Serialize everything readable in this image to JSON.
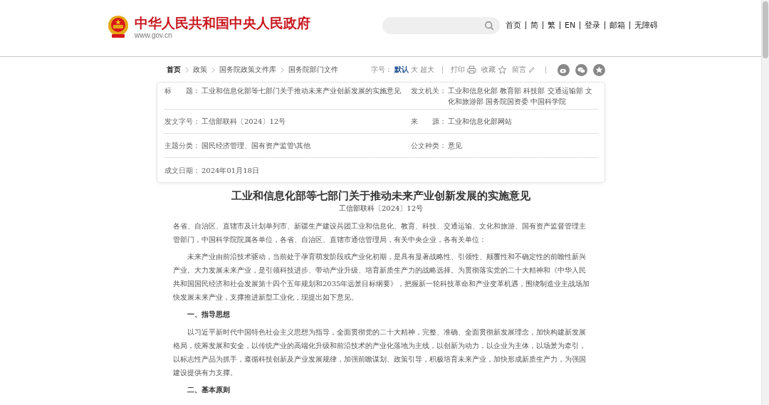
{
  "header": {
    "site_title": "中华人民共和国中央人民政府",
    "site_url": "www.gov.cn",
    "nav": [
      "首页",
      "简",
      "繁",
      "EN",
      "登录",
      "邮箱",
      "无障碍"
    ]
  },
  "breadcrumb": [
    "首页",
    "政策",
    "国务院政策文件库",
    "国务院部门文件"
  ],
  "toolbar": {
    "font_size_label": "字号：",
    "font_sizes": [
      {
        "label": "默认",
        "selected": true
      },
      {
        "label": "大",
        "selected": false
      },
      {
        "label": "超大",
        "selected": false
      }
    ],
    "print": "打印",
    "favorite": "收藏",
    "comment": "留言"
  },
  "info": [
    {
      "label": "标　　题：",
      "value": "工业和信息化部等七部门关于推动未来产业创新发展的实施意见"
    },
    {
      "label": "发文机关：",
      "value": "工业和信息化部  教育部  科技部  交通运输部  文化和旅游部  国务院国资委  中国科学院"
    },
    {
      "label": "发文字号：",
      "value": "工信部联科〔2024〕12号"
    },
    {
      "label": "来　　源：",
      "value": "工业和信息化部网站"
    },
    {
      "label": "主题分类：",
      "value": "国民经济管理、国有资产监管\\其他"
    },
    {
      "label": "公文种类：",
      "value": "意见"
    },
    {
      "label": "成文日期：",
      "value": "2024年01月18日"
    }
  ],
  "article": {
    "title": "工业和信息化部等七部门关于推动未来产业创新发展的实施意见",
    "doc_number": "工信部联科〔2024〕12号",
    "blocks": [
      {
        "kind": "salutation",
        "text": "各省、自治区、直辖市及计划单列市、新疆生产建设兵团工业和信息化、教育、科技、交通运输、文化和旅游、国有资产监督管理主管部门，中国科学院院属各单位，各省、自治区、直辖市通信管理局，有关中央企业，各有关单位："
      },
      {
        "kind": "paragraph",
        "text": "未来产业由前沿技术驱动，当前处于孕育萌发阶段或产业化初期，是具有显著战略性、引领性、颠覆性和不确定性的前瞻性新兴产业。大力发展未来产业，是引领科技进步、带动产业升级、培育新质生产力的战略选择。为贯彻落实党的二十大精神和《中华人民共和国国民经济和社会发展第十四个五年规划和2035年远景目标纲要》，把握新一轮科技革命和产业变革机遇，围绕制造业主战场加快发展未来产业，支撑推进新型工业化，现提出如下意见。"
      },
      {
        "kind": "heading",
        "text": "一、指导思想"
      },
      {
        "kind": "paragraph",
        "text": "以习近平新时代中国特色社会主义思想为指导，全面贯彻党的二十大精神，完整、准确、全面贯彻新发展理念，加快构建新发展格局，统筹发展和安全，以传统产业的高端化升级和前沿技术的产业化落地为主线，以创新为动力，以企业为主体，以场景为牵引，以标志性产品为抓手，遵循科技创新及产业发展规律，加强前瞻谋划、政策引导，积极培育未来产业，加快形成新质生产力，为强国建设提供有力支撑。"
      },
      {
        "kind": "heading",
        "text": "二、基本原则"
      }
    ]
  }
}
